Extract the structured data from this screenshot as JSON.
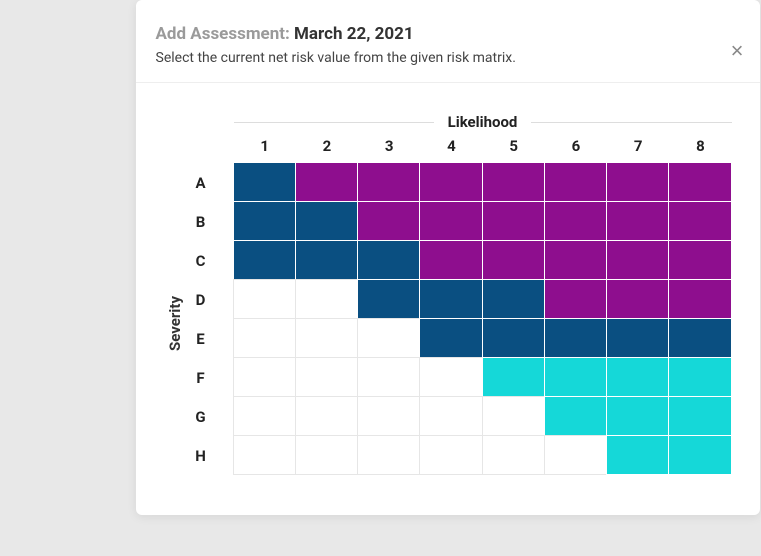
{
  "header": {
    "title_prefix": "Add Assessment:",
    "title_date": "March 22, 2021",
    "subtitle": "Select the current net risk value from the given risk matrix.",
    "close_glyph": "×"
  },
  "axes": {
    "likelihood_label": "Likelihood",
    "severity_label": "Severity",
    "cols": [
      "1",
      "2",
      "3",
      "4",
      "5",
      "6",
      "7",
      "8"
    ],
    "rows": [
      "A",
      "B",
      "C",
      "D",
      "E",
      "F",
      "G",
      "H"
    ]
  },
  "colors": {
    "white": "#ffffff",
    "cyan": "#15d8d8",
    "navy": "#0a4f81",
    "purple": "#8e0e8e"
  },
  "matrix": [
    [
      "navy",
      "purple",
      "purple",
      "purple",
      "purple",
      "purple",
      "purple",
      "purple"
    ],
    [
      "navy",
      "navy",
      "purple",
      "purple",
      "purple",
      "purple",
      "purple",
      "purple"
    ],
    [
      "navy",
      "navy",
      "navy",
      "purple",
      "purple",
      "purple",
      "purple",
      "purple"
    ],
    [
      "white",
      "white",
      "navy",
      "navy",
      "navy",
      "purple",
      "purple",
      "purple"
    ],
    [
      "white",
      "white",
      "white",
      "navy",
      "navy",
      "navy",
      "navy",
      "navy"
    ],
    [
      "white",
      "white",
      "white",
      "white",
      "cyan",
      "cyan",
      "cyan",
      "cyan"
    ],
    [
      "white",
      "white",
      "white",
      "white",
      "white",
      "cyan",
      "cyan",
      "cyan"
    ],
    [
      "white",
      "white",
      "white",
      "white",
      "white",
      "white",
      "cyan",
      "cyan"
    ]
  ]
}
